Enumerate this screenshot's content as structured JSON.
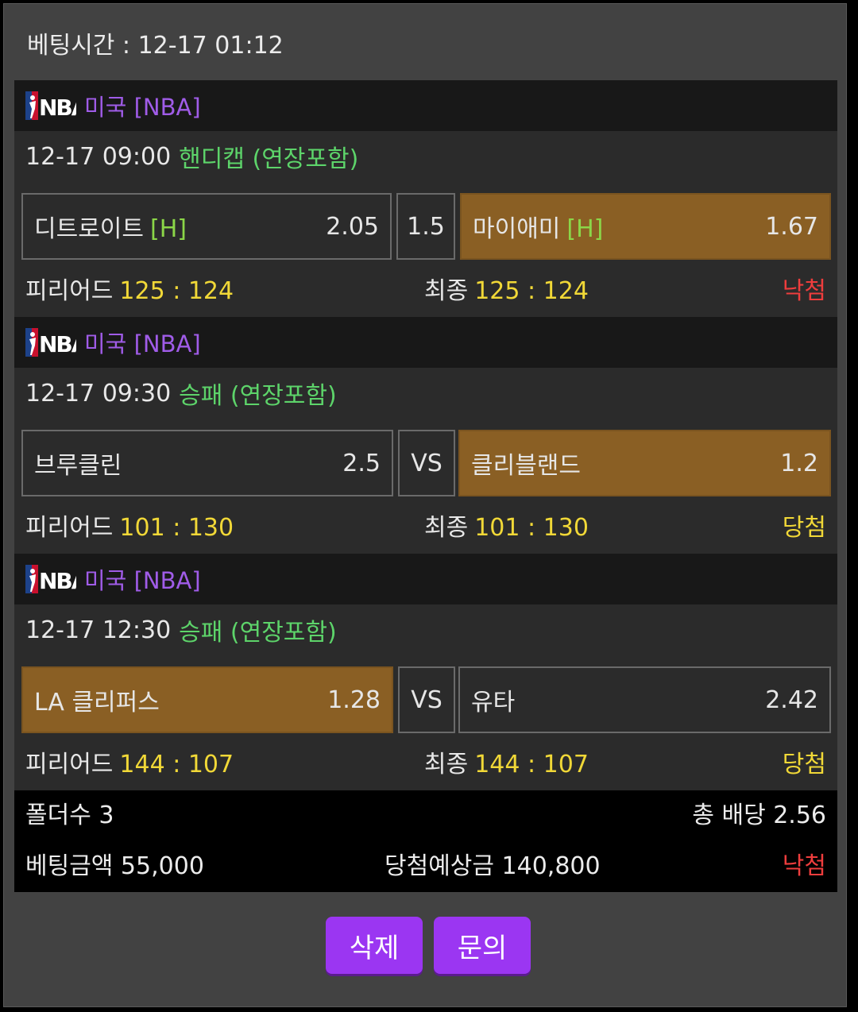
{
  "header": {
    "bet_time": "베팅시간 : 12-17 01:12"
  },
  "colors": {
    "selected": "#8a5f24",
    "league": "#a05ce8",
    "market": "#5dd46a",
    "score": "#f1d837",
    "lose": "#ee3d3d",
    "button": "#9b36f2"
  },
  "games": [
    {
      "league": "미국 [NBA]",
      "datetime": "12-17 09:00",
      "market": "핸디캡 (연장포함)",
      "home": {
        "name": "디트로이트",
        "tag": "[H]",
        "odd": "2.05"
      },
      "center": "1.5",
      "away": {
        "name": "마이애미",
        "tag": "[H]",
        "odd": "1.67"
      },
      "period_label": "피리어드",
      "period_score": "125 : 124",
      "final_label": "최종",
      "final_score": "125 : 124",
      "result": "낙첨"
    },
    {
      "league": "미국 [NBA]",
      "datetime": "12-17 09:30",
      "market": "승패 (연장포함)",
      "home": {
        "name": "브루클린",
        "tag": "",
        "odd": "2.5"
      },
      "center": "VS",
      "away": {
        "name": "클리블랜드",
        "tag": "",
        "odd": "1.2"
      },
      "period_label": "피리어드",
      "period_score": "101 : 130",
      "final_label": "최종",
      "final_score": "101 : 130",
      "result": "당첨"
    },
    {
      "league": "미국 [NBA]",
      "datetime": "12-17 12:30",
      "market": "승패 (연장포함)",
      "home": {
        "name": "LA 클리퍼스",
        "tag": "",
        "odd": "1.28"
      },
      "center": "VS",
      "away": {
        "name": "유타",
        "tag": "",
        "odd": "2.42"
      },
      "period_label": "피리어드",
      "period_score": "144 : 107",
      "final_label": "최종",
      "final_score": "144 : 107",
      "result": "당첨"
    }
  ],
  "summary": {
    "folders": "폴더수 3",
    "total_odds": "총 배당 2.56",
    "bet_amount": "베팅금액 55,000",
    "expected_win": "당첨예상금 140,800",
    "result": "낙첨"
  },
  "buttons": {
    "delete": "삭제",
    "inquiry": "문의"
  }
}
